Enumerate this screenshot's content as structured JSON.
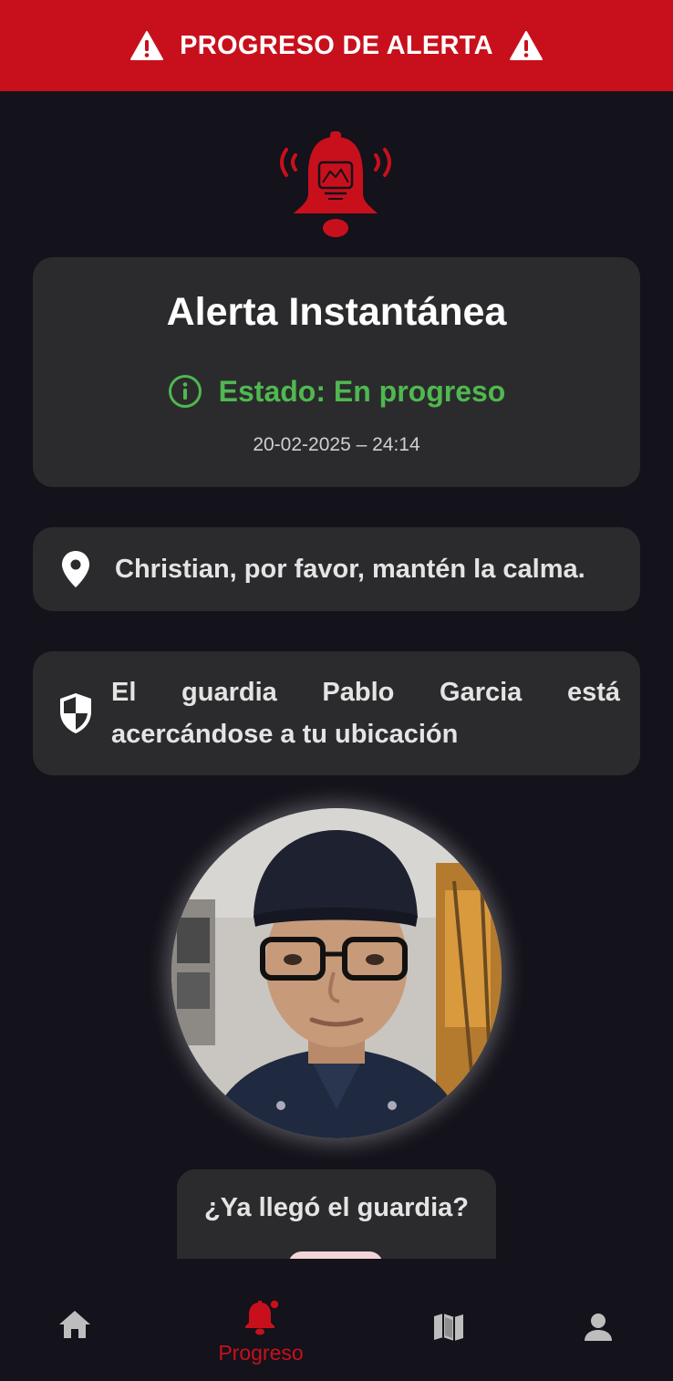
{
  "header": {
    "title": "PROGRESO DE ALERTA"
  },
  "alert": {
    "title": "Alerta Instantánea",
    "status": "Estado: En progreso",
    "datetime": "20-02-2025 – 24:14"
  },
  "messages": {
    "calm": "Christian, por favor, mantén la calma.",
    "guard": "El guardia Pablo Garcia está acercándose a tu ubicación"
  },
  "arrival": {
    "question": "¿Ya llegó el guardia?"
  },
  "nav": {
    "active_label": "Progreso"
  },
  "colors": {
    "accent": "#c8101c",
    "status_green": "#4fb84f",
    "background": "#14121a",
    "card": "#2b2b2d"
  },
  "icons": [
    "warning-icon",
    "bell-alarm-icon",
    "info-icon",
    "location-pin-icon",
    "shield-icon",
    "home-icon",
    "bell-icon",
    "map-icon",
    "person-icon"
  ]
}
